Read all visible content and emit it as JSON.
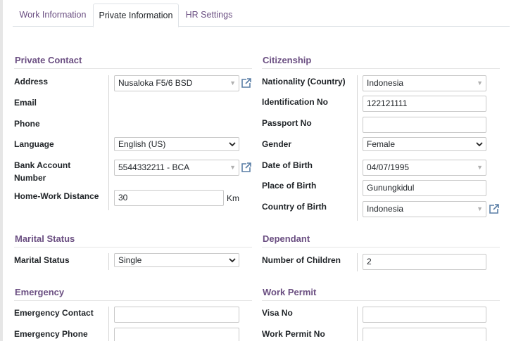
{
  "tabs": [
    {
      "label": "Work Information"
    },
    {
      "label": "Private Information"
    },
    {
      "label": "HR Settings"
    }
  ],
  "private_contact": {
    "title": "Private Contact",
    "address_label": "Address",
    "address_value": "Nusaloka F5/6 BSD",
    "email_label": "Email",
    "phone_label": "Phone",
    "language_label": "Language",
    "language_value": "English (US)",
    "bank_label_1": "Bank Account",
    "bank_label_2": "Number",
    "bank_value": "5544332211 - BCA",
    "distance_label": "Home-Work Distance",
    "distance_value": "30",
    "distance_unit": "Km"
  },
  "citizenship": {
    "title": "Citizenship",
    "nationality_label": "Nationality (Country)",
    "nationality_value": "Indonesia",
    "id_label": "Identification No",
    "id_value": "122121111",
    "passport_label": "Passport No",
    "passport_value": "",
    "gender_label": "Gender",
    "gender_value": "Female",
    "dob_label": "Date of Birth",
    "dob_value": "04/07/1995",
    "pob_label": "Place of Birth",
    "pob_value": "Gunungkidul",
    "cob_label": "Country of Birth",
    "cob_value": "Indonesia"
  },
  "marital": {
    "title": "Marital Status",
    "status_label": "Marital Status",
    "status_value": "Single"
  },
  "dependant": {
    "title": "Dependant",
    "children_label": "Number of Children",
    "children_value": "2"
  },
  "emergency": {
    "title": "Emergency",
    "contact_label": "Emergency Contact",
    "phone_label": "Emergency Phone"
  },
  "work_permit": {
    "title": "Work Permit",
    "visa_label": "Visa No",
    "permit_label": "Work Permit No"
  },
  "colors": {
    "accent": "#6b4f82",
    "border": "#c9c9c9"
  }
}
